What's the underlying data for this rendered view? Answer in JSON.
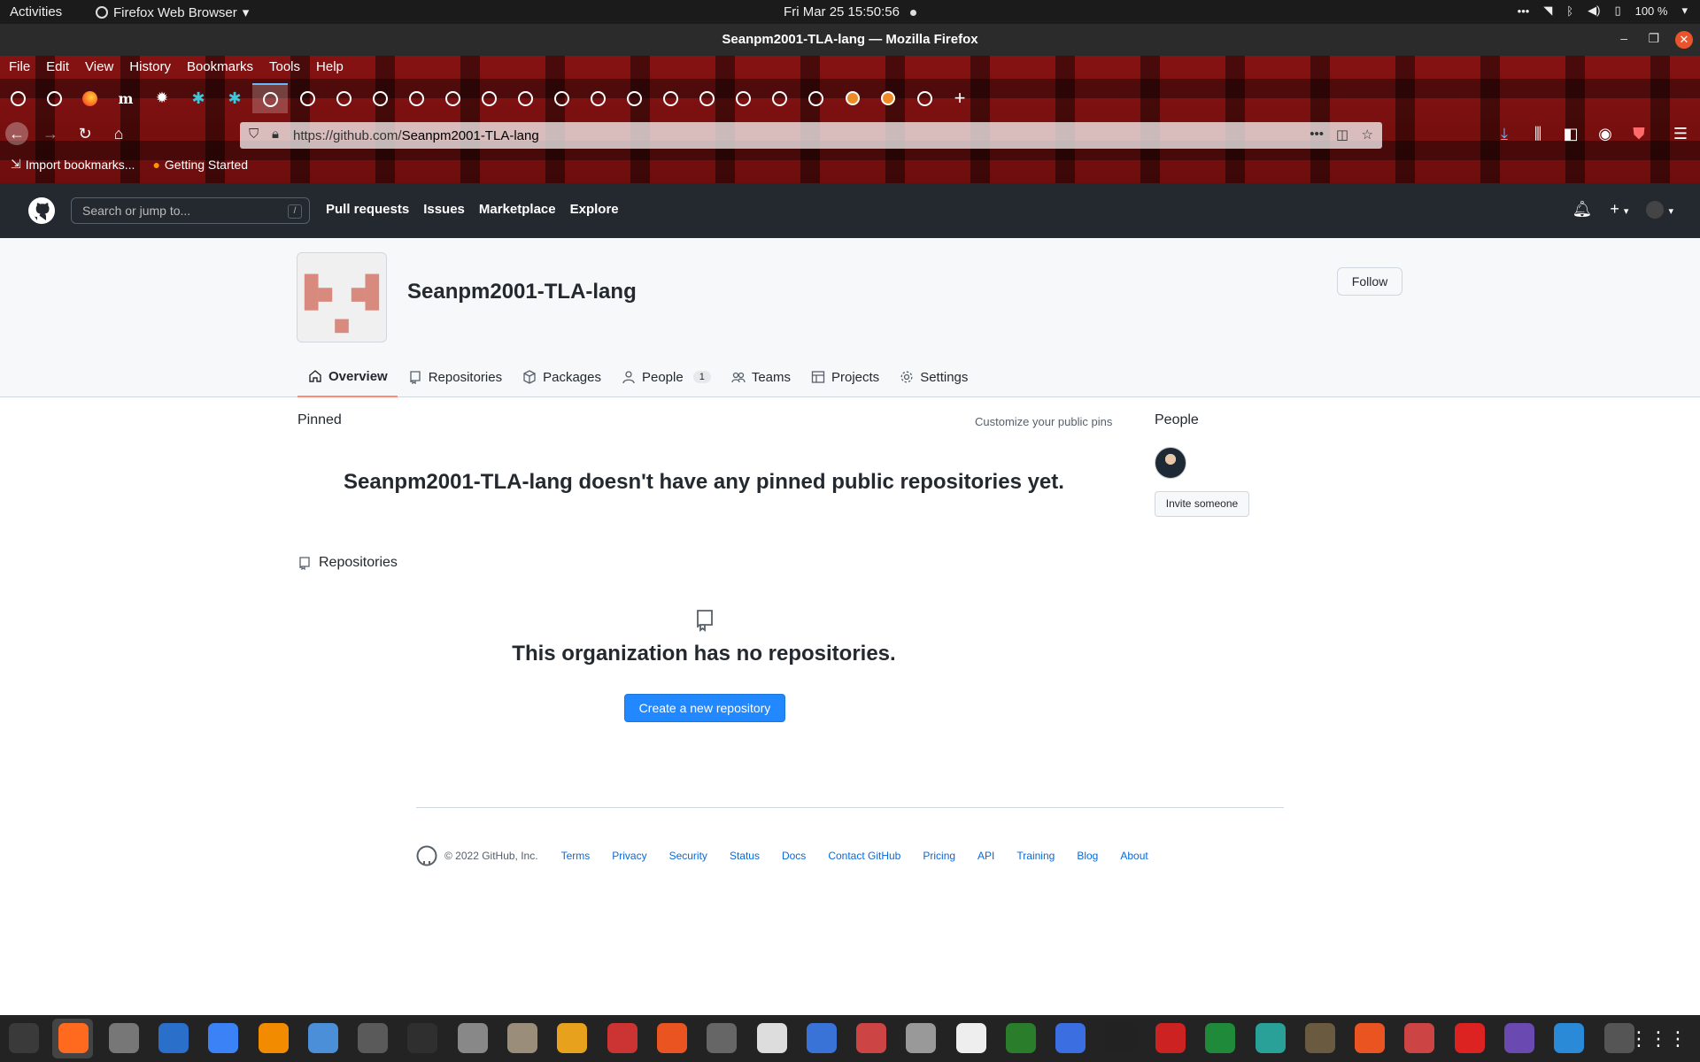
{
  "topbar": {
    "activities": "Activities",
    "app_name": "Firefox Web Browser",
    "clock": "Fri Mar 25  15:50:56",
    "battery": "100 %"
  },
  "window": {
    "title": "Seanpm2001-TLA-lang — Mozilla Firefox"
  },
  "menu": [
    "File",
    "Edit",
    "View",
    "History",
    "Bookmarks",
    "Tools",
    "Help"
  ],
  "tabs": [
    "github",
    "github",
    "firefox",
    "m",
    "gear",
    "tinker",
    "tinker",
    "github",
    "github",
    "github",
    "github",
    "github",
    "github",
    "github",
    "github",
    "github",
    "github",
    "github",
    "github",
    "github",
    "github",
    "github",
    "github",
    "orange",
    "orange",
    "github"
  ],
  "urlbar": {
    "prefix": "https://github.com/",
    "path": "Seanpm2001-TLA-lang"
  },
  "bookmarks": [
    "Import bookmarks...",
    "Getting Started"
  ],
  "gh_header": {
    "search_placeholder": "Search or jump to...",
    "slash": "/",
    "nav": [
      "Pull requests",
      "Issues",
      "Marketplace",
      "Explore"
    ]
  },
  "org": {
    "name": "Seanpm2001-TLA-lang",
    "follow_label": "Follow",
    "tabs": [
      {
        "label": "Overview",
        "icon": "home-icon"
      },
      {
        "label": "Repositories",
        "icon": "repo-icon"
      },
      {
        "label": "Packages",
        "icon": "package-icon"
      },
      {
        "label": "People",
        "icon": "person-icon",
        "count": "1"
      },
      {
        "label": "Teams",
        "icon": "people-icon"
      },
      {
        "label": "Projects",
        "icon": "table-icon"
      },
      {
        "label": "Settings",
        "icon": "gear-icon"
      }
    ]
  },
  "main": {
    "pinned_heading": "Pinned",
    "customize_pins": "Customize your public pins",
    "no_pins": "Seanpm2001-TLA-lang doesn't have any pinned public repositories yet.",
    "repos_heading": "Repositories",
    "no_repos": "This organization has no repositories.",
    "create_repo": "Create a new repository"
  },
  "sidebar": {
    "people_heading": "People",
    "invite_label": "Invite someone"
  },
  "footer": {
    "copyright": "© 2022 GitHub, Inc.",
    "links": [
      "Terms",
      "Privacy",
      "Security",
      "Status",
      "Docs",
      "Contact GitHub",
      "Pricing",
      "API",
      "Training",
      "Blog",
      "About"
    ]
  },
  "colors": {
    "gh_header": "#24292f",
    "primary_button": "#2188ff",
    "active_tab_underline": "#fd8c73",
    "link": "#0969da",
    "avatar_pink": "#d98a7f"
  }
}
